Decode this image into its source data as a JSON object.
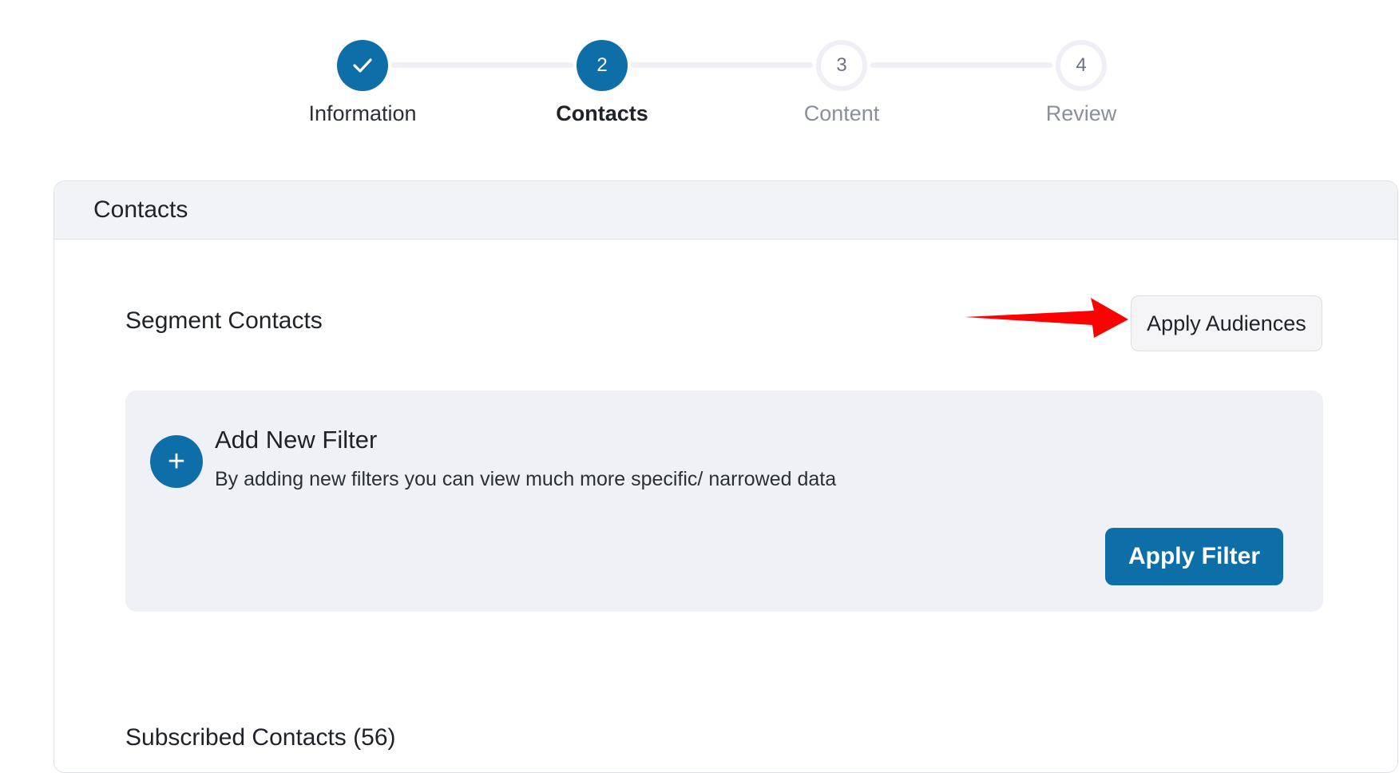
{
  "stepper": {
    "steps": [
      {
        "number": "",
        "label": "Information",
        "state": "done",
        "icon": "check-icon"
      },
      {
        "number": "2",
        "label": "Contacts",
        "state": "active"
      },
      {
        "number": "3",
        "label": "Content",
        "state": "pending"
      },
      {
        "number": "4",
        "label": "Review",
        "state": "pending"
      }
    ]
  },
  "card": {
    "header_title": "Contacts",
    "segment_title": "Segment Contacts",
    "apply_audiences_label": "Apply Audiences",
    "filter": {
      "plus_symbol": "+",
      "title": "Add New Filter",
      "description": "By adding new filters you can view much more specific/ narrowed data",
      "apply_label": "Apply Filter"
    },
    "subscribed_title": "Subscribed Contacts (56)"
  },
  "colors": {
    "primary": "#0e6fa8",
    "annotation_arrow": "#ff0000"
  }
}
